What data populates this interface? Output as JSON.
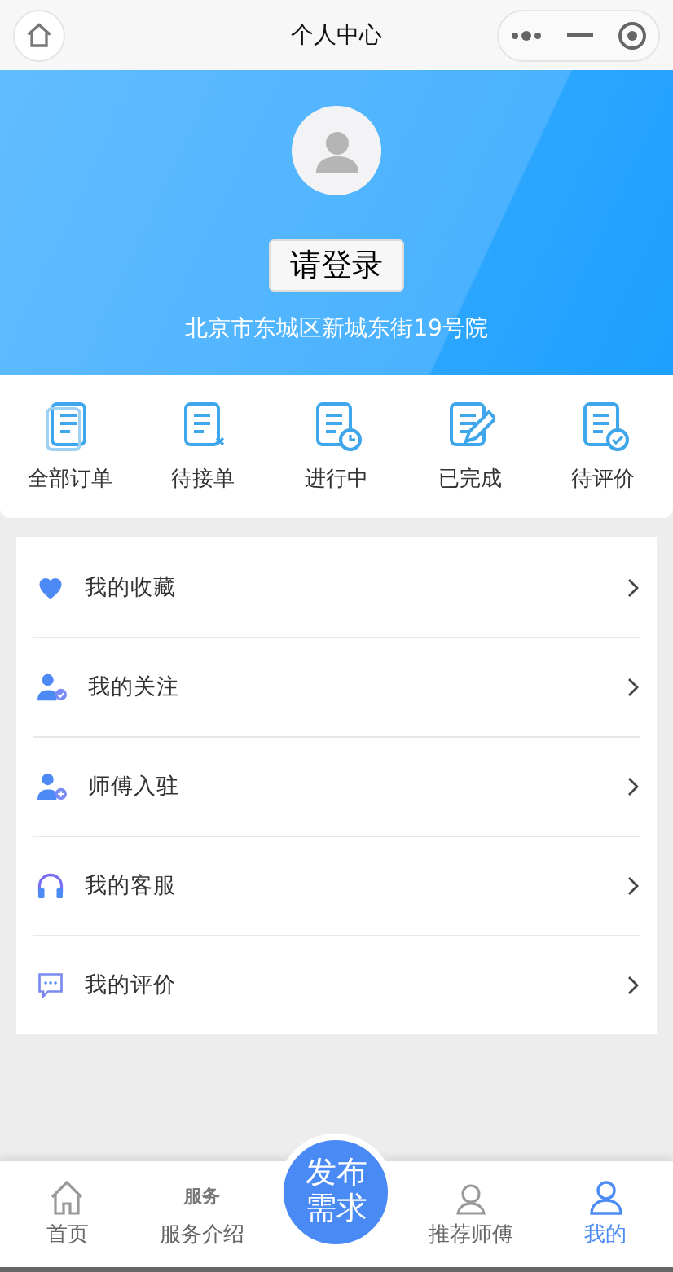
{
  "nav_bar": {
    "title": "个人中心"
  },
  "profile": {
    "login_button": "请登录",
    "address": "北京市东城区新城东街19号院"
  },
  "orders": [
    {
      "label": "全部订单",
      "kind": "all"
    },
    {
      "label": "待接单",
      "kind": "pending"
    },
    {
      "label": "进行中",
      "kind": "progress"
    },
    {
      "label": "已完成",
      "kind": "done"
    },
    {
      "label": "待评价",
      "kind": "review"
    }
  ],
  "menu": [
    {
      "label": "我的收藏",
      "kind": "heart"
    },
    {
      "label": "我的关注",
      "kind": "follow"
    },
    {
      "label": "师傅入驻",
      "kind": "join"
    },
    {
      "label": "我的客服",
      "kind": "headset"
    },
    {
      "label": "我的评价",
      "kind": "chat"
    }
  ],
  "tab_bar": {
    "tabs": [
      {
        "label": "首页",
        "kind": "home",
        "selected": false
      },
      {
        "label": "服务介绍",
        "kind": "service",
        "icon_text": "服务",
        "selected": false
      },
      {
        "label": "推荐师傅",
        "kind": "worker",
        "selected": false
      },
      {
        "label": "我的",
        "kind": "me",
        "selected": true
      }
    ],
    "publish_button": "发布需求"
  }
}
